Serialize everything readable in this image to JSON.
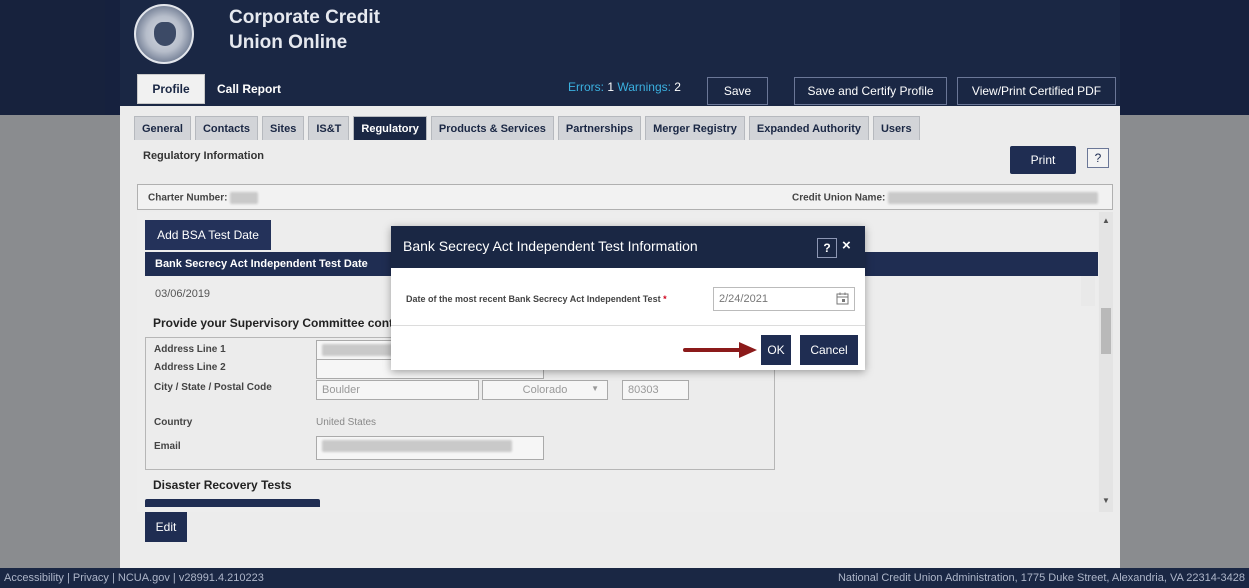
{
  "app": {
    "title_line1": "Corporate Credit",
    "title_line2": "Union Online"
  },
  "nav": {
    "profile": "Profile",
    "call_report": "Call Report",
    "errors_label": "Errors:",
    "errors_count": "1",
    "warnings_label": "Warnings:",
    "warnings_count": "2",
    "save": "Save",
    "save_certify": "Save and Certify Profile",
    "view_print": "View/Print Certified PDF"
  },
  "tabs": [
    "General",
    "Contacts",
    "Sites",
    "IS&T",
    "Regulatory",
    "Products & Services",
    "Partnerships",
    "Merger Registry",
    "Expanded Authority",
    "Users"
  ],
  "active_tab": "Regulatory",
  "section": {
    "title": "Regulatory Information",
    "print": "Print",
    "help": "?"
  },
  "charter": {
    "charter_label": "Charter Number:",
    "cu_name_label": "Credit Union Name:"
  },
  "content": {
    "add_bsa": "Add BSA Test Date",
    "bsa_header": "Bank Secrecy Act Independent Test Date",
    "bsa_date": "03/06/2019",
    "provide": "Provide your Supervisory Committee cont",
    "address_line1": "Address Line 1",
    "address_line2": "Address Line 2",
    "city_state_zip": "City / State / Postal Code",
    "city": "Boulder",
    "state": "Colorado",
    "zip": "80303",
    "country_label": "Country",
    "country_value": "United States",
    "email_label": "Email",
    "disaster": "Disaster Recovery Tests",
    "edit": "Edit"
  },
  "modal": {
    "title": "Bank Secrecy Act Independent Test Information",
    "help": "?",
    "close": "×",
    "date_label": "Date of the most recent Bank Secrecy Act Independent Test",
    "required": "*",
    "date_value": "2/24/2021",
    "ok": "OK",
    "cancel": "Cancel"
  },
  "footer": {
    "left": "Accessibility | Privacy | NCUA.gov | v28991.4.210223",
    "right": "National Credit Union Administration, 1775 Duke Street, Alexandria, VA 22314-3428"
  }
}
